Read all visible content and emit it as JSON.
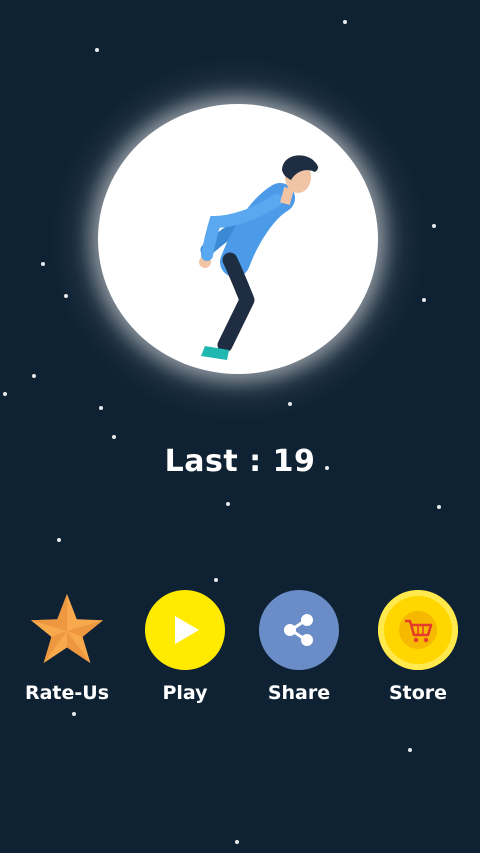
{
  "score": {
    "label": "Last : 19"
  },
  "menu": {
    "rate": {
      "label": "Rate-Us",
      "icon": "star-icon",
      "color": "#f7a94b"
    },
    "play": {
      "label": "Play",
      "icon": "play-icon",
      "color": "#ffea00"
    },
    "share": {
      "label": "Share",
      "icon": "share-icon",
      "color": "#6a8cc7"
    },
    "store": {
      "label": "Store",
      "icon": "cart-icon",
      "color": "#ffd600"
    }
  },
  "colors": {
    "background": "#0f2234",
    "moon": "#ffffff",
    "text": "#ffffff"
  }
}
